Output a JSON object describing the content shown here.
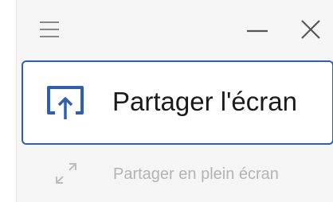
{
  "colors": {
    "accent": "#2f5fb0",
    "icon_gray": "#8a8a8a",
    "disabled_text": "#b3b3b3",
    "panel_bg": "#f5f5f5"
  },
  "titlebar": {
    "menu_icon": "hamburger-menu-icon",
    "minimize_icon": "minimize-icon",
    "close_icon": "close-icon"
  },
  "options": {
    "share_screen": {
      "label": "Partager l'écran",
      "icon": "screen-share-icon",
      "selected": true
    },
    "share_fullscreen": {
      "label": "Partager en plein écran",
      "icon": "expand-arrows-icon",
      "disabled": true
    }
  }
}
